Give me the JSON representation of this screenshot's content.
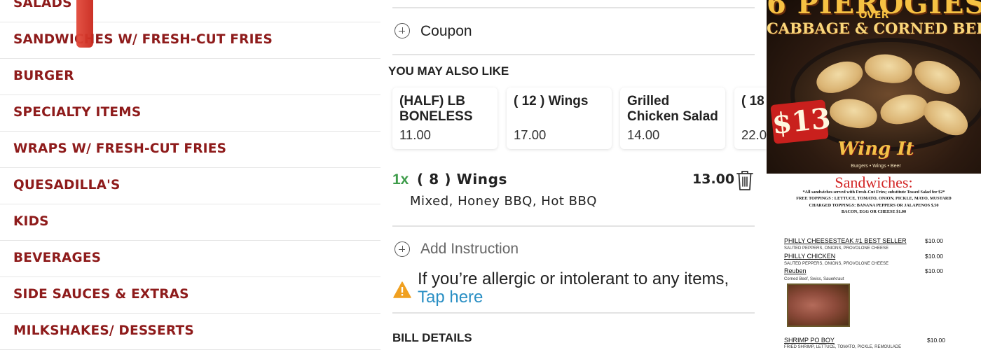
{
  "categories": [
    "SALADS",
    "SANDWICHES W/ FRESH-CUT FRIES",
    "BURGER",
    "SPECIALTY ITEMS",
    "WRAPS W/ FRESH-CUT FRIES",
    "QUESADILLA'S",
    "KIDS",
    "BEVERAGES",
    "SIDE SAUCES & EXTRAS",
    "MILKSHAKES/ DESSERTS"
  ],
  "cart": {
    "coupon_label": "Coupon",
    "suggestions_title": "YOU MAY ALSO LIKE",
    "suggestions": [
      {
        "name": "(HALF) LB BONELESS",
        "price": "11.00"
      },
      {
        "name": "( 12 ) Wings",
        "price": "17.00"
      },
      {
        "name": "Grilled Chicken Salad",
        "price": "14.00"
      },
      {
        "name": "( 18",
        "price": "22.0"
      }
    ],
    "item": {
      "qty": "1x",
      "name": "( 8 ) Wings",
      "modifiers": "Mixed, Honey BBQ, Hot BBQ",
      "price": "13.00"
    },
    "add_instruction_label": "Add Instruction",
    "allergy_text": "If you’re allergic or intolerant to any items,",
    "allergy_link": "Tap here",
    "bill_details_title": "BILL DETAILS"
  },
  "promo": {
    "headline": "6 PIEROGIES",
    "over": "OVER",
    "subline": "CABBAGE & CORNED BEEF",
    "price": "$13",
    "logo": "Wing It",
    "tagline": "Burgers • Wings • Beer"
  },
  "menu_sheet": {
    "title": "Sandwiches:",
    "notes": [
      "*All sandwiches served with Fresh-Cut Fries; substitute Tossed Salad for $2*",
      "FREE TOPPINGS : LETTUCE, TOMATO, ONION, PICKLE, MAYO, MUSTARD",
      "CHARGED TOPPINGS: BANANA PEPPERS OR JALAPENOS $.50",
      "BACON, EGG OR CHEESE $1.00"
    ],
    "items": [
      {
        "name": "PHILLY CHEESESTEAK #1 BEST SELLER",
        "desc": "SAUTED PEPPERS, ONIONS, PROVOLONE CHEESE",
        "price": "$10.00"
      },
      {
        "name": "PHILLY CHICKEN",
        "desc": "SAUTED PEPPERS, ONIONS, PROVOLONE CHEESE",
        "price": "$10.00"
      },
      {
        "name": "Reuben",
        "desc": "Corned Beef, Swiss, Sauerkraut",
        "price": "$10.00"
      },
      {
        "name": "SHRIMP PO BOY",
        "desc": "FRIED SHRIMP, LETTUCE, TOMATO, PICKLE, REMOULADE",
        "price": "$10.00"
      }
    ]
  },
  "colors": {
    "category_text": "#8e1b1b",
    "qty_green": "#3e9c4a",
    "link_blue": "#2a8fc4",
    "warning_orange": "#f0a020"
  }
}
